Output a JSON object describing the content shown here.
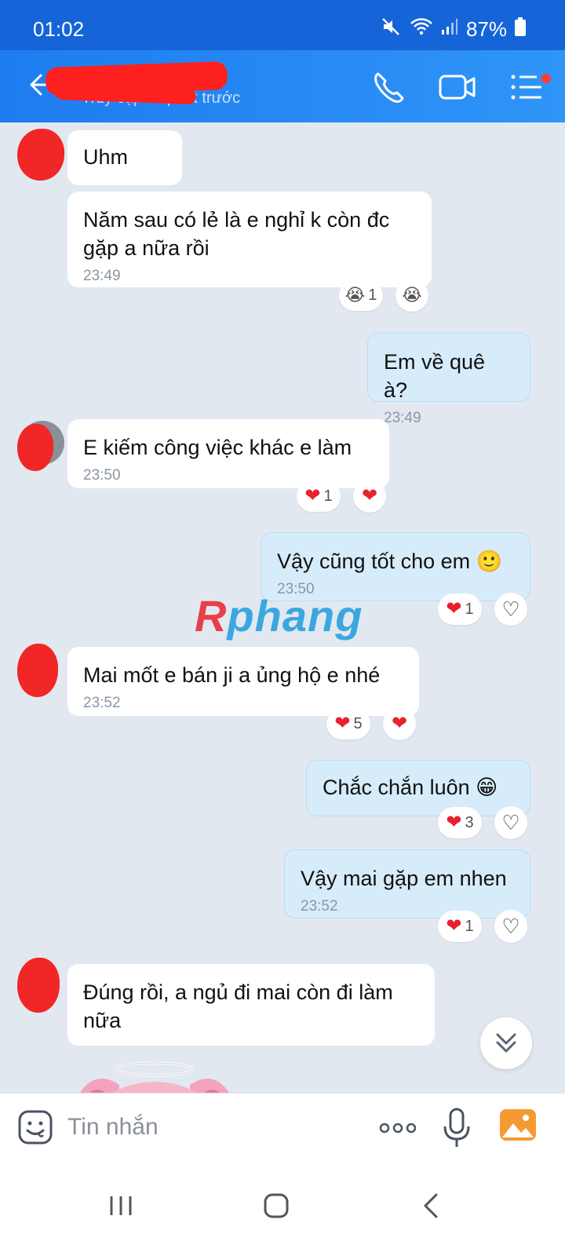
{
  "status_bar": {
    "time": "01:02",
    "battery": "87%"
  },
  "header": {
    "subtitle": "Truy cập 11 phút trước"
  },
  "messages": [
    {
      "text": "Uhm",
      "time": ""
    },
    {
      "text": "Năm sau có lẻ là e nghỉ k còn đc gặp a nữa rồi",
      "time": "23:49",
      "reaction_count": "1"
    },
    {
      "text": "Em về quê à?",
      "time": "23:49"
    },
    {
      "text": "E kiếm công việc khác e làm",
      "time": "23:50",
      "reaction_count": "1"
    },
    {
      "text": "Vậy cũng tốt cho em 🙂",
      "time": "23:50",
      "reaction_count": "1"
    },
    {
      "text": "Mai mốt e bán ji a ủng hộ e nhé",
      "time": "23:52",
      "reaction_count": "5"
    },
    {
      "text": "Chắc chắn luôn 😁",
      "time": "",
      "reaction_count": "3"
    },
    {
      "text": "Vậy mai gặp em nhen",
      "time": "23:52",
      "reaction_count": "1"
    },
    {
      "text": "Đúng rồi, a ngủ đi mai còn đi làm nữa",
      "time": ""
    }
  ],
  "watermark": {
    "first": "R",
    "rest": "phang"
  },
  "input": {
    "placeholder": "Tin nhắn"
  },
  "colors": {
    "header": "#2f95f7",
    "outgoing_bubble": "#d6ecfb",
    "incoming_bubble": "#ffffff",
    "heart": "#e8202f"
  },
  "icons": [
    "back-arrow-icon",
    "phone-icon",
    "video-camera-icon",
    "menu-list-icon",
    "emoji-icon",
    "more-icon",
    "microphone-icon",
    "image-icon",
    "chevron-double-down-icon",
    "recent-apps-icon",
    "home-icon",
    "nav-back-icon"
  ]
}
